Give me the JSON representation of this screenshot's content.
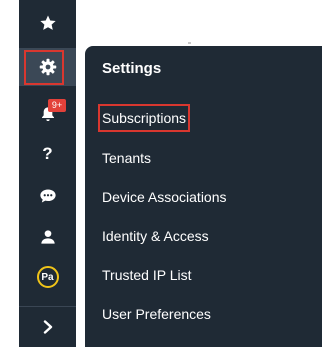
{
  "rail": {
    "items": [
      {
        "name": "favorites",
        "icon": "star-icon"
      },
      {
        "name": "settings",
        "icon": "gear-icon",
        "selected": true
      },
      {
        "name": "notifications",
        "icon": "bell-icon",
        "badge": "9+"
      },
      {
        "name": "help",
        "icon": "question-icon",
        "glyph": "?"
      },
      {
        "name": "chat",
        "icon": "chat-bubble-icon"
      },
      {
        "name": "user",
        "icon": "user-icon"
      },
      {
        "name": "profile",
        "icon": "avatar",
        "initials": "Pa"
      },
      {
        "name": "expand",
        "icon": "chevron-right-icon"
      }
    ]
  },
  "settings_menu": {
    "title": "Settings",
    "items": [
      {
        "label": "Subscriptions",
        "active": true
      },
      {
        "label": "Tenants"
      },
      {
        "label": "Device Associations"
      },
      {
        "label": "Identity & Access"
      },
      {
        "label": "Trusted IP List"
      },
      {
        "label": "User Preferences"
      }
    ]
  },
  "colors": {
    "sidebar_bg": "#1f2a35",
    "selected_bg": "#3b4856",
    "highlight": "#d9372f",
    "badge_bg": "#e3413a",
    "avatar_ring": "#f0c419",
    "text": "#ffffff"
  }
}
